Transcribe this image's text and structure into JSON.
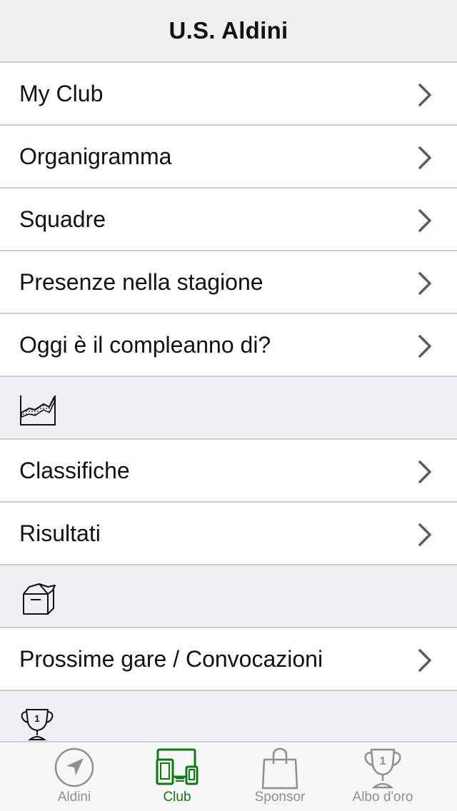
{
  "navbar": {
    "title": "U.S. Aldini"
  },
  "menu": {
    "club_items": [
      {
        "label": "My Club"
      },
      {
        "label": "Organigramma"
      },
      {
        "label": "Squadre"
      },
      {
        "label": "Presenze nella stagione"
      },
      {
        "label": "Oggi è il compleanno di?"
      }
    ],
    "stats_section_icon": "chart-area-icon",
    "stats_items": [
      {
        "label": "Classifiche"
      },
      {
        "label": "Risultati"
      }
    ],
    "matches_section_icon": "open-box-icon",
    "matches_items": [
      {
        "label": "Prossime gare / Convocazioni"
      }
    ],
    "trophy_section_icon": "trophy-icon"
  },
  "tabbar": {
    "tabs": [
      {
        "label": "Aldini",
        "icon": "navigation-arrow-icon"
      },
      {
        "label": "Club",
        "icon": "devices-icon",
        "active": true
      },
      {
        "label": "Sponsor",
        "icon": "shopping-bag-icon"
      },
      {
        "label": "Albo d'oro",
        "icon": "trophy-icon"
      }
    ]
  },
  "colors": {
    "accent": "#0d7a12",
    "inactive": "#8e8e93",
    "separator": "#cfcfd2",
    "section_bg": "#efeff4",
    "chevron": "#5a5a60"
  }
}
